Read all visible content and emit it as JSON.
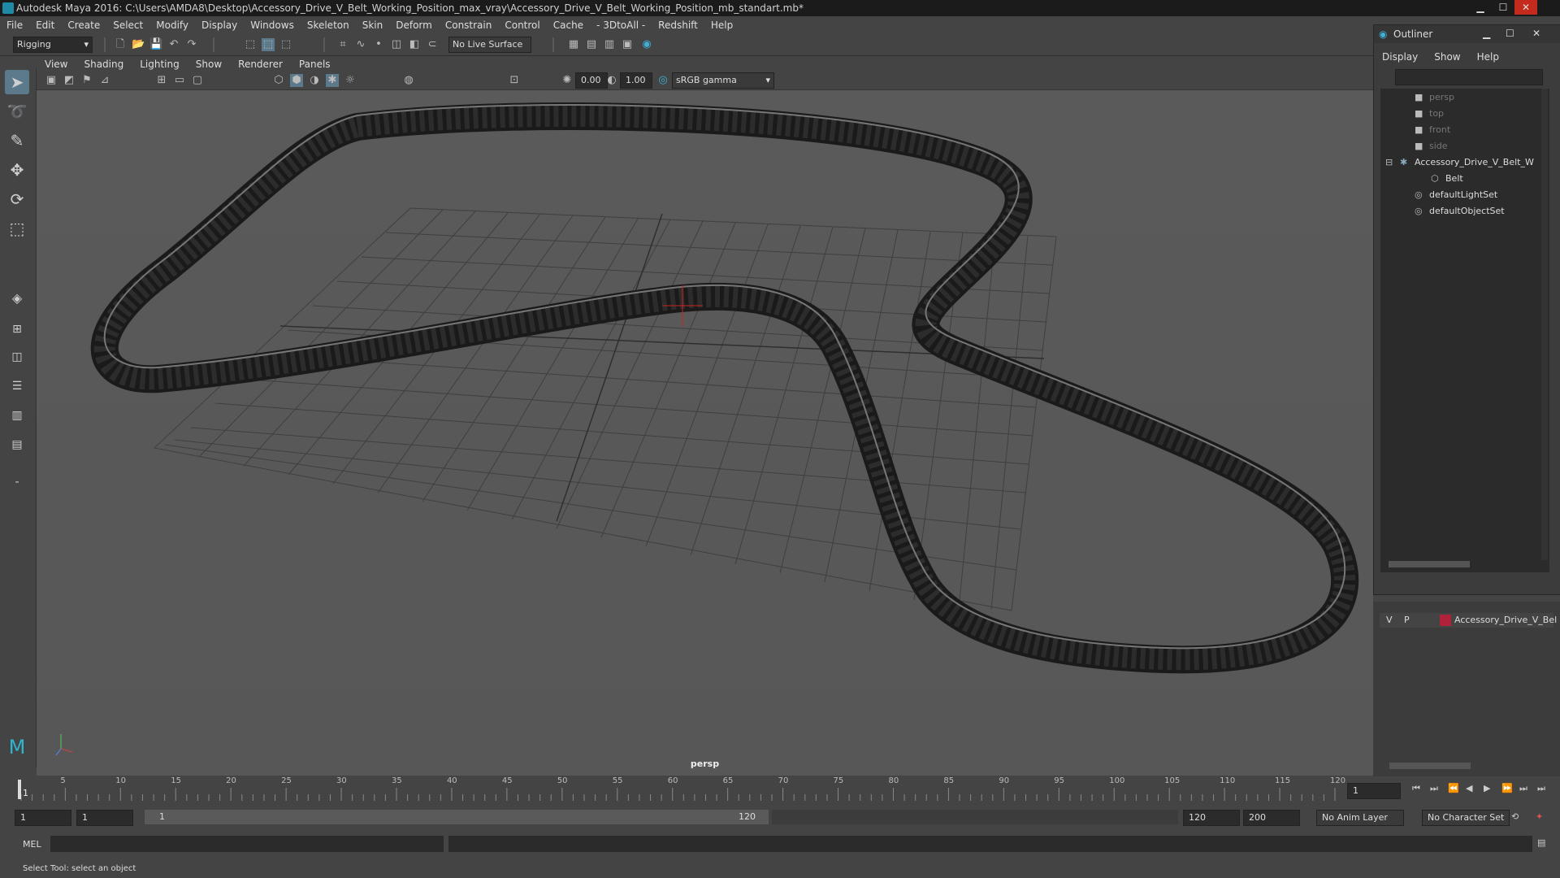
{
  "window": {
    "title": "Autodesk Maya 2016: C:\\Users\\AMDA8\\Desktop\\Accessory_Drive_V_Belt_Working_Position_max_vray\\Accessory_Drive_V_Belt_Working_Position_mb_standart.mb*",
    "min": "▁",
    "max": "☐",
    "close": "✕"
  },
  "menubar": [
    "File",
    "Edit",
    "Create",
    "Select",
    "Modify",
    "Display",
    "Windows",
    "Skeleton",
    "Skin",
    "Deform",
    "Constrain",
    "Control",
    "Cache",
    "- 3DtoAll -",
    "Redshift",
    "Help"
  ],
  "shelf": {
    "mode": "Rigging",
    "live_surface": "No Live Surface"
  },
  "panel": {
    "menu": [
      "View",
      "Shading",
      "Lighting",
      "Show",
      "Renderer",
      "Panels"
    ],
    "exposure": "0.00",
    "gamma": "1.00",
    "colorspace": "sRGB gamma",
    "camera_label": "persp"
  },
  "outliner": {
    "title": "Outliner",
    "menu": [
      "Display",
      "Show",
      "Help"
    ],
    "items": [
      {
        "label": "persp",
        "icon": "camera-icon",
        "dim": true
      },
      {
        "label": "top",
        "icon": "camera-icon",
        "dim": true
      },
      {
        "label": "front",
        "icon": "camera-icon",
        "dim": true
      },
      {
        "label": "side",
        "icon": "camera-icon",
        "dim": true
      },
      {
        "label": "Accessory_Drive_V_Belt_W",
        "icon": "group-icon",
        "dim": false
      },
      {
        "label": "Belt",
        "icon": "mesh-icon",
        "dim": false
      },
      {
        "label": "defaultLightSet",
        "icon": "set-icon",
        "dim": false
      },
      {
        "label": "defaultObjectSet",
        "icon": "set-icon",
        "dim": false
      }
    ]
  },
  "layers": {
    "v": "V",
    "p": "P",
    "name": "Accessory_Drive_V_Bel",
    "color": "#b0213a"
  },
  "timeline": {
    "current_frame": "1",
    "ticks": [
      "5",
      "10",
      "15",
      "20",
      "25",
      "30",
      "35",
      "40",
      "45",
      "50",
      "55",
      "60",
      "65",
      "70",
      "75",
      "80",
      "85",
      "90",
      "95",
      "100",
      "105",
      "110",
      "115",
      "120"
    ],
    "start_label": "1"
  },
  "range": {
    "start": "1",
    "start2": "1",
    "slider_start": "1",
    "slider_end": "120",
    "end": "120",
    "max": "200",
    "anim_layer": "No Anim Layer",
    "char_set": "No Character Set"
  },
  "cmd": {
    "lang": "MEL"
  },
  "help": "Select Tool: select an object"
}
